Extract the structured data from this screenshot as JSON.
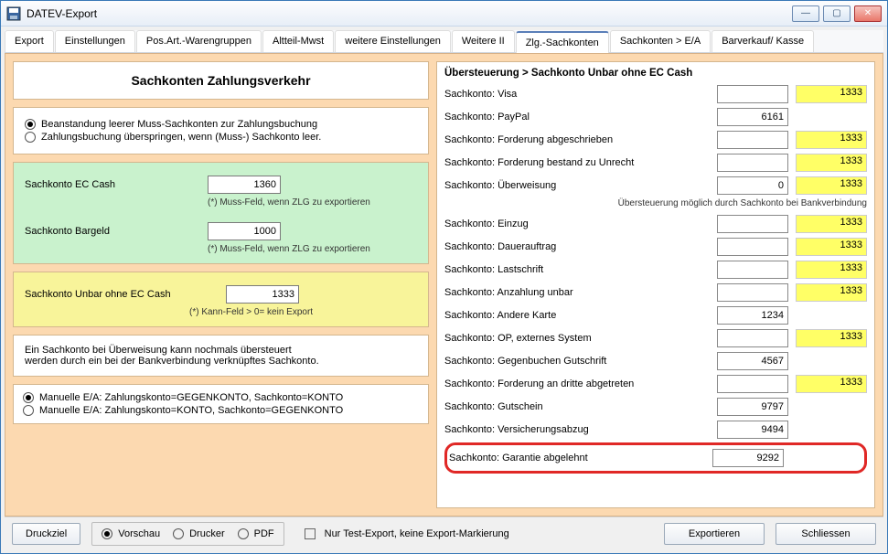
{
  "window": {
    "title": "DATEV-Export"
  },
  "tabs": [
    "Export",
    "Einstellungen",
    "Pos.Art.-Warengruppen",
    "Altteil-Mwst",
    "weitere Einstellungen",
    "Weitere II",
    "Zlg.-Sachkonten",
    "Sachkonten > E/A",
    "Barverkauf/ Kasse"
  ],
  "left": {
    "heading": "Sachkonten Zahlungsverkehr",
    "radioA": [
      "Beanstandung leerer Muss-Sachkonten zur Zahlungsbuchung",
      "Zahlungsbuchung überspringen, wenn (Muss-) Sachkonto leer."
    ],
    "green": {
      "eccash": {
        "label": "Sachkonto EC Cash",
        "value": "1360"
      },
      "bargeld": {
        "label": "Sachkonto Bargeld",
        "value": "1000"
      },
      "hint": "(*) Muss-Feld, wenn ZLG zu exportieren"
    },
    "yellow": {
      "unbar": {
        "label": "Sachkonto Unbar ohne EC Cash",
        "value": "1333"
      },
      "hint": "(*) Kann-Feld > 0= kein Export"
    },
    "note": [
      "Ein Sachkonto bei Überweisung kann nochmals übersteuert",
      "werden durch ein bei der Bankverbindung verknüpftes Sachkonto."
    ],
    "radioB": [
      "Manuelle E/A: Zahlungskonto=GEGENKONTO, Sachkonto=KONTO",
      "Manuelle E/A: Zahlungskonto=KONTO, Sachkonto=GEGENKONTO"
    ]
  },
  "right": {
    "heading": "Übersteuerung > Sachkonto Unbar ohne EC Cash",
    "overrideHint": "Übersteuerung möglich durch Sachkonto bei Bankverbindung",
    "rows": [
      {
        "label": "Sachkonto: Visa",
        "value": "",
        "fallback": "1333"
      },
      {
        "label": "Sachkonto: PayPal",
        "value": "6161",
        "fallback": ""
      },
      {
        "label": "Sachkonto: Forderung abgeschrieben",
        "value": "",
        "fallback": "1333"
      },
      {
        "label": "Sachkonto: Forderung bestand zu Unrecht",
        "value": "",
        "fallback": "1333"
      },
      {
        "label": "Sachkonto: Überweisung",
        "value": "0",
        "fallback": "1333",
        "hintAfter": true
      },
      {
        "label": "Sachkonto: Einzug",
        "value": "",
        "fallback": "1333"
      },
      {
        "label": "Sachkonto: Dauerauftrag",
        "value": "",
        "fallback": "1333"
      },
      {
        "label": "Sachkonto: Lastschrift",
        "value": "",
        "fallback": "1333"
      },
      {
        "label": "Sachkonto: Anzahlung unbar",
        "value": "",
        "fallback": "1333"
      },
      {
        "label": "Sachkonto: Andere Karte",
        "value": "1234",
        "fallback": ""
      },
      {
        "label": "Sachkonto: OP, externes System",
        "value": "",
        "fallback": "1333"
      },
      {
        "label": "Sachkonto: Gegenbuchen Gutschrift",
        "value": "4567",
        "fallback": ""
      },
      {
        "label": "Sachkonto: Forderung an dritte abgetreten",
        "value": "",
        "fallback": "1333"
      },
      {
        "label": "Sachkonto: Gutschein",
        "value": "9797",
        "fallback": ""
      },
      {
        "label": "Sachkonto: Versicherungsabzug",
        "value": "9494",
        "fallback": ""
      },
      {
        "label": "Sachkonto: Garantie abgelehnt",
        "value": "9292",
        "fallback": "",
        "highlight": true
      }
    ]
  },
  "bottom": {
    "druckziel": "Druckziel",
    "targets": [
      "Vorschau",
      "Drucker",
      "PDF"
    ],
    "testexport": "Nur Test-Export, keine Export-Markierung",
    "export": "Exportieren",
    "close": "Schliessen"
  }
}
